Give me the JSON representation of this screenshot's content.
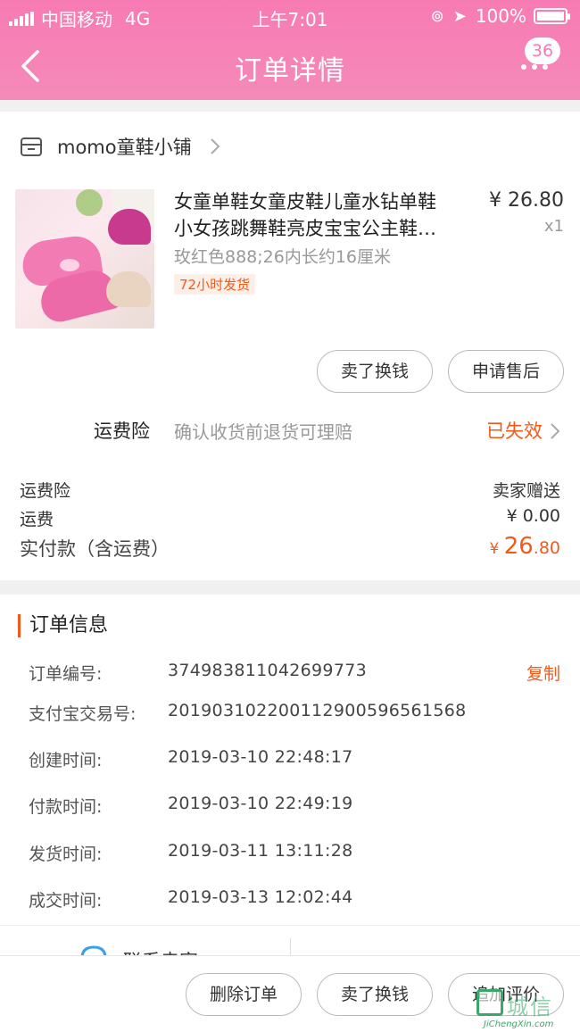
{
  "status_bar": {
    "carrier": "中国移动",
    "network": "4G",
    "time": "上午7:01",
    "battery": "100%"
  },
  "nav": {
    "title": "订单详情",
    "badge_count": "36"
  },
  "shop": {
    "name": "momo童鞋小铺"
  },
  "product": {
    "title_line1": "女童单鞋女童皮鞋儿童水钻单鞋",
    "title_line2": "小女孩跳舞鞋亮皮宝宝公主鞋…",
    "price": "¥ 26.80",
    "qty": "x1",
    "sku": "玫红色888;26内长约16厘米",
    "tag": "72小时发货"
  },
  "item_actions": {
    "exchange_label": "卖了换钱",
    "aftersale_label": "申请售后"
  },
  "insurance": {
    "label": "运费险",
    "desc": "确认收货前退货可理赔",
    "status": "已失效"
  },
  "fees": {
    "insurance_label": "运费险",
    "insurance_value": "卖家赠送",
    "shipping_label": "运费",
    "shipping_value": "¥ 0.00",
    "paid_label": "实付款（含运费）",
    "paid_currency": "¥ ",
    "paid_int": "26",
    "paid_dec": ".80"
  },
  "order_info": {
    "title": "订单信息",
    "copy_label": "复制",
    "rows": [
      {
        "label": "订单编号:",
        "value": "374983811042699773"
      },
      {
        "label": "支付宝交易号:",
        "value": "2019031022001129005965615​68"
      },
      {
        "label": "创建时间:",
        "value": "2019-03-10 22:48:17"
      },
      {
        "label": "付款时间:",
        "value": "2019-03-10 22:49:19"
      },
      {
        "label": "发货时间:",
        "value": "2019-03-11 13:11:28"
      },
      {
        "label": "成交时间:",
        "value": "2019-03-13 12:02:44"
      }
    ]
  },
  "contact": {
    "label": "联系卖家"
  },
  "bottom_actions": {
    "delete_label": "删除订单",
    "exchange_label": "卖了换钱",
    "review_label": "追加评价"
  },
  "watermark": {
    "text": "城信",
    "sub": "JiChengXin.com"
  },
  "colors": {
    "header": "#f77bb3",
    "accent": "#f25a1c"
  }
}
